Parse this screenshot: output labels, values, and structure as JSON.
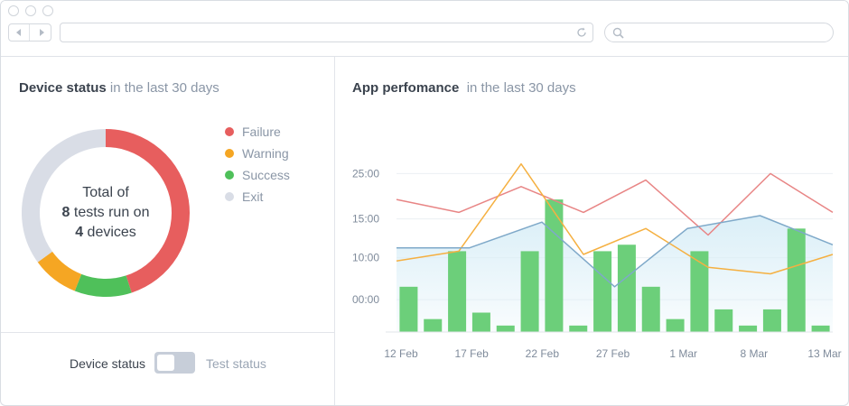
{
  "browser": {
    "address": "",
    "search_placeholder": ""
  },
  "device_status": {
    "title": "Device status",
    "subtitle": "in the last 30 days",
    "center_line1": "Total of",
    "center_count": "8",
    "center_line2_rest": " tests run on",
    "center_devices_count": "4",
    "center_devices_label": " devices",
    "legend": [
      {
        "label": "Failure",
        "color": "#e75e5e"
      },
      {
        "label": "Warning",
        "color": "#f5a623"
      },
      {
        "label": "Success",
        "color": "#4fc05a"
      },
      {
        "label": "Exit",
        "color": "#d9dde6"
      }
    ],
    "slices_percent": [
      {
        "label": "Failure",
        "value": 45
      },
      {
        "label": "Success",
        "value": 11
      },
      {
        "label": "Warning",
        "value": 9
      },
      {
        "label": "Exit",
        "value": 35
      }
    ],
    "toggle": {
      "left_label": "Device status",
      "right_label": "Test status",
      "active": "Device status"
    }
  },
  "app_performance": {
    "title": "App perfomance",
    "subtitle": "in the last 30 days"
  },
  "chart_data": {
    "type": "bar",
    "y_tick_labels": [
      "25:00",
      "15:00",
      "10:00",
      "00:00"
    ],
    "x_tick_labels": [
      "12 Feb",
      "17 Feb",
      "22 Feb",
      "27 Feb",
      "1 Mar",
      "8 Mar",
      "13 Mar"
    ],
    "ylim": [
      0,
      30
    ],
    "grid": true,
    "bars": {
      "color": "#6ccf7a",
      "values": [
        7,
        2,
        12.5,
        3,
        1,
        12.5,
        20.5,
        1,
        12.5,
        13.5,
        7,
        2,
        12.5,
        3.5,
        1,
        3.5,
        16,
        1
      ]
    },
    "series": [
      {
        "color": "#e88585",
        "values": [
          20.5,
          18.5,
          22.5,
          18.5,
          23.5,
          15,
          24.5,
          18.5
        ]
      },
      {
        "color": "#f5b041",
        "values": [
          11,
          12.5,
          26,
          12,
          16,
          10,
          9,
          12
        ]
      },
      {
        "color": "#7fa9c9",
        "fill": "#d9eef7",
        "values": [
          13,
          13,
          17,
          7,
          16,
          18,
          13.5
        ]
      }
    ]
  }
}
